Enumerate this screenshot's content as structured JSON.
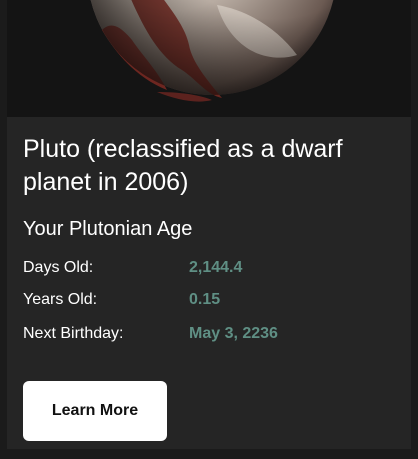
{
  "card": {
    "title": "Pluto (reclassified as a dwarf planet in 2006)",
    "subtitle": "Your Plutonian Age",
    "stats": [
      {
        "label": "Days Old:",
        "value": "2,144.4"
      },
      {
        "label": "Years Old:",
        "value": "0.15"
      },
      {
        "label": "Next Birthday:",
        "value": "May 3, 2236"
      }
    ],
    "button_label": "Learn More"
  },
  "colors": {
    "background": "#1b1b1b",
    "card": "#252525",
    "stat_value": "#5f8f84",
    "button": "#ffffff"
  }
}
